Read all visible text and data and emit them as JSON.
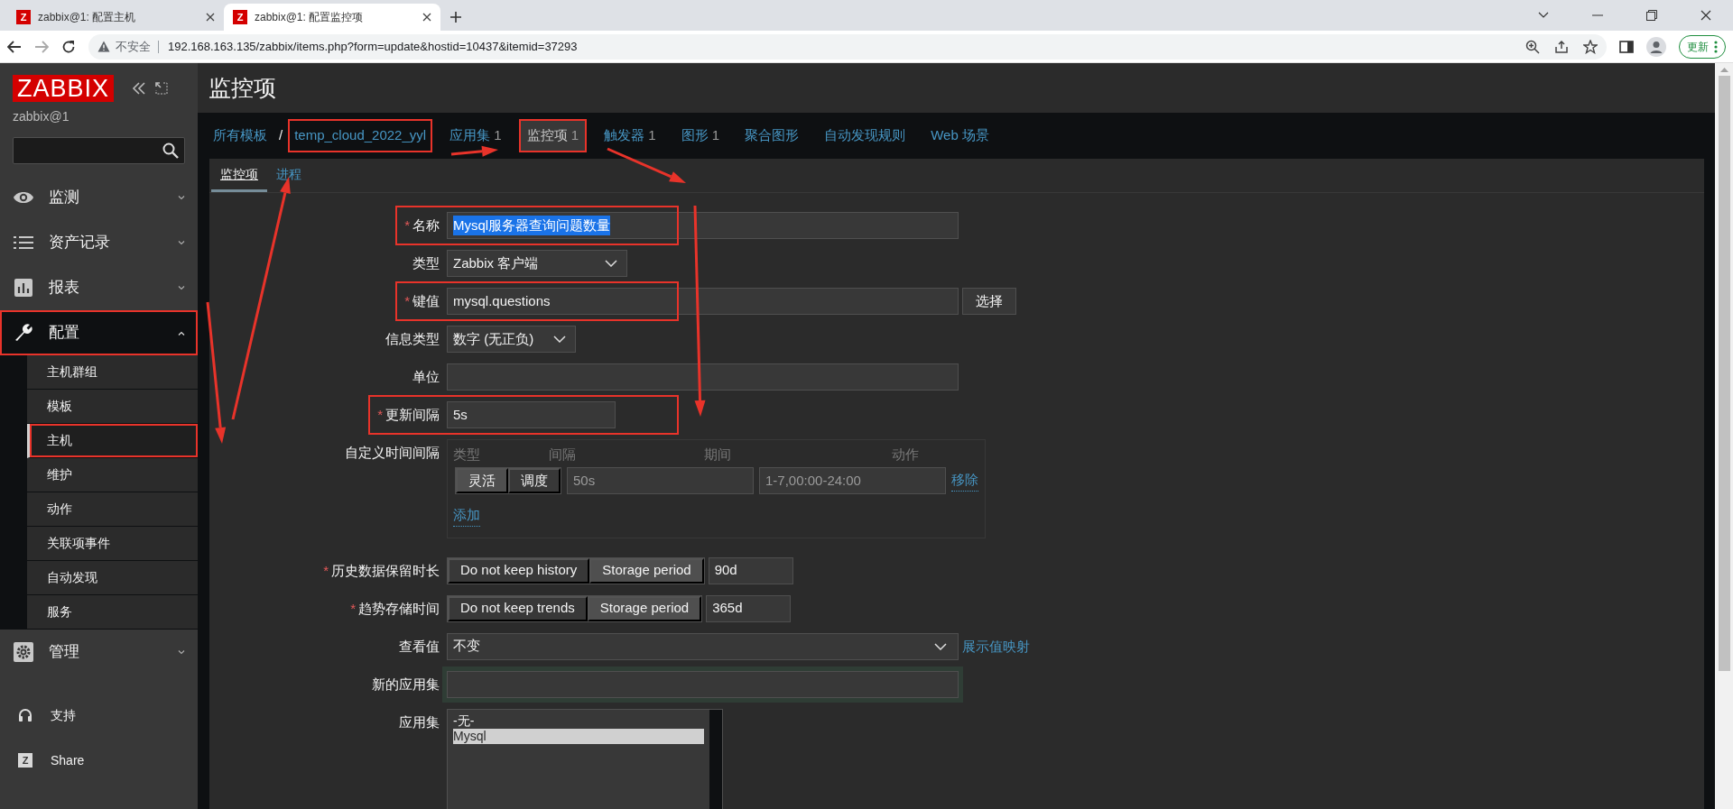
{
  "browser": {
    "tabs": [
      {
        "icon_text": "Z",
        "title": "zabbix@1: 配置主机",
        "selected": false
      },
      {
        "icon_text": "Z",
        "title": "zabbix@1: 配置监控项",
        "selected": true
      }
    ],
    "security_label": "不安全",
    "url": "192.168.163.135/zabbix/items.php?form=update&hostid=10437&itemid=37293",
    "update_button": "更新"
  },
  "sidebar": {
    "logo": "ZABBIX",
    "user": "zabbix@1",
    "menu": [
      {
        "label": "监测",
        "expanded": false,
        "highlighted": false
      },
      {
        "label": "资产记录",
        "expanded": false,
        "highlighted": false
      },
      {
        "label": "报表",
        "expanded": false,
        "highlighted": false
      },
      {
        "label": "配置",
        "expanded": true,
        "highlighted": true,
        "children": [
          {
            "label": "主机群组",
            "selected": false,
            "highlighted": false
          },
          {
            "label": "模板",
            "selected": false,
            "highlighted": false
          },
          {
            "label": "主机",
            "selected": true,
            "highlighted": true
          },
          {
            "label": "维护",
            "selected": false,
            "highlighted": false
          },
          {
            "label": "动作",
            "selected": false,
            "highlighted": false
          },
          {
            "label": "关联项事件",
            "selected": false,
            "highlighted": false
          },
          {
            "label": "自动发现",
            "selected": false,
            "highlighted": false
          },
          {
            "label": "服务",
            "selected": false,
            "highlighted": false
          }
        ]
      },
      {
        "label": "管理",
        "expanded": false,
        "highlighted": false
      }
    ],
    "links": [
      {
        "label": "支持"
      },
      {
        "label": "Share",
        "icon_text": "Z"
      }
    ]
  },
  "header": {
    "title": "监控项"
  },
  "navigation": {
    "separator": "/",
    "breadcrumbs": [
      {
        "label": "所有模板",
        "highlighted": false
      },
      {
        "label": "temp_cloud_2022_yyl",
        "highlighted": true
      }
    ],
    "items": [
      {
        "label": "应用集",
        "count": "1",
        "selected": false,
        "highlighted": false
      },
      {
        "label": "监控项",
        "count": "1",
        "selected": true,
        "highlighted": true
      },
      {
        "label": "触发器",
        "count": "1",
        "selected": false,
        "highlighted": false
      },
      {
        "label": "图形",
        "count": "1",
        "selected": false,
        "highlighted": false
      },
      {
        "label": "聚合图形",
        "selected": false,
        "highlighted": false
      },
      {
        "label": "自动发现规则",
        "selected": false,
        "highlighted": false
      },
      {
        "label": "Web 场景",
        "selected": false,
        "highlighted": false
      }
    ]
  },
  "tabs": [
    {
      "label": "监控项",
      "selected": true
    },
    {
      "label": "进程",
      "selected": false
    }
  ],
  "form": {
    "rows": [
      {
        "kind": "text",
        "label": "名称",
        "required_mark": "*",
        "value": "Mysql服务器查询问题数量",
        "value_selected": true,
        "highlighted": true
      },
      {
        "kind": "select",
        "label": "类型",
        "value": "Zabbix 客户端"
      },
      {
        "kind": "text_button",
        "label": "键值",
        "required_mark": "*",
        "value": "mysql.questions",
        "button": "选择",
        "highlighted": true
      },
      {
        "kind": "select",
        "label": "信息类型",
        "value": "数字 (无正负)"
      },
      {
        "kind": "text",
        "label": "单位"
      },
      {
        "kind": "short_text",
        "label": "更新间隔",
        "required_mark": "*",
        "value": "5s",
        "highlighted": true
      },
      {
        "kind": "intervals",
        "label": "自定义时间间隔",
        "columns": [
          "类型",
          "间隔",
          "期间",
          "动作"
        ],
        "entries": [
          {
            "modes": [
              {
                "label": "灵活",
                "selected": true
              },
              {
                "label": "调度",
                "selected": false
              }
            ],
            "interval": "50s",
            "period": "1-7,00:00-24:00",
            "remove": "移除"
          }
        ],
        "add": "添加"
      },
      {
        "kind": "storage",
        "label": "历史数据保留时长",
        "required_mark": "*",
        "options": [
          {
            "label": "Do not keep history",
            "selected": false
          },
          {
            "label": "Storage period",
            "selected": true
          }
        ],
        "value": "90d"
      },
      {
        "kind": "storage",
        "label": "趋势存储时间",
        "required_mark": "*",
        "options": [
          {
            "label": "Do not keep trends",
            "selected": false
          },
          {
            "label": "Storage period",
            "selected": true
          }
        ],
        "value": "365d"
      },
      {
        "kind": "select_link",
        "label": "查看值",
        "value": "不变",
        "link": "展示值映射"
      },
      {
        "kind": "text",
        "label": "新的应用集",
        "focused": true
      },
      {
        "kind": "listbox",
        "label": "应用集",
        "options": [
          {
            "label": "-无-",
            "selected": false
          },
          {
            "label": "Mysql",
            "selected": true
          }
        ]
      }
    ]
  }
}
